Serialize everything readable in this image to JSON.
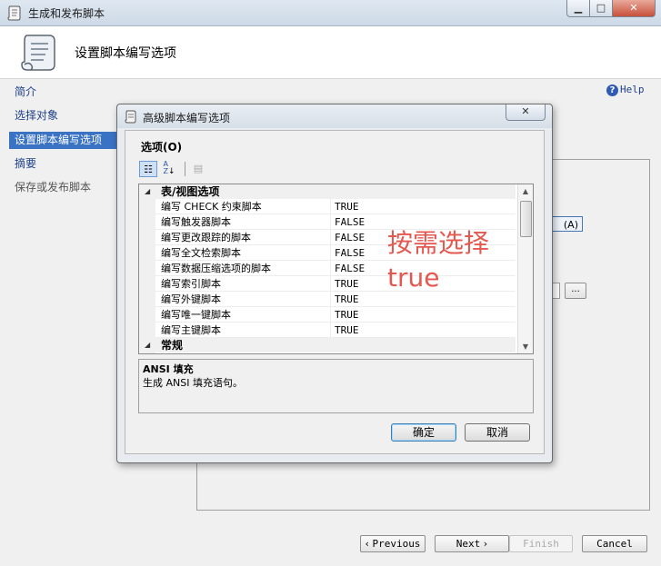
{
  "window": {
    "title": "生成和发布脚本"
  },
  "header": {
    "title": "设置脚本编写选项"
  },
  "help": {
    "label": "Help"
  },
  "nav": {
    "items": [
      {
        "label": "简介",
        "state": "link"
      },
      {
        "label": "选择对象",
        "state": "link"
      },
      {
        "label": "设置脚本编写选项",
        "state": "selected"
      },
      {
        "label": "摘要",
        "state": "link"
      },
      {
        "label": "保存或发布脚本",
        "state": "disabled"
      }
    ]
  },
  "background": {
    "hidden_button_suffix": "(A)",
    "browse_label": "..."
  },
  "wizard_buttons": {
    "previous": "Previous",
    "next": "Next",
    "finish": "Finish",
    "cancel": "Cancel"
  },
  "dialog": {
    "title": "高级脚本编写选项",
    "options_label": "选项(O)",
    "categories": [
      {
        "label": "表/视图选项",
        "expanded": true,
        "rows": [
          {
            "name": "编写 CHECK 约束脚本",
            "value": "TRUE"
          },
          {
            "name": "编写触发器脚本",
            "value": "FALSE"
          },
          {
            "name": "编写更改跟踪的脚本",
            "value": "FALSE"
          },
          {
            "name": "编写全文检索脚本",
            "value": "FALSE"
          },
          {
            "name": "编写数据压缩选项的脚本",
            "value": "FALSE"
          },
          {
            "name": "编写索引脚本",
            "value": "TRUE"
          },
          {
            "name": "编写外键脚本",
            "value": "TRUE"
          },
          {
            "name": "编写唯一键脚本",
            "value": "TRUE"
          },
          {
            "name": "编写主键脚本",
            "value": "TRUE"
          }
        ]
      },
      {
        "label": "常规",
        "expanded": true,
        "rows": []
      }
    ],
    "annotation": "按需选择true",
    "description": {
      "title": "ANSI 填充",
      "text": "生成 ANSI 填充语句。"
    },
    "ok_label": "确定",
    "cancel_label": "取消"
  },
  "colors": {
    "nav_selected": "#3a72c4",
    "annotation": "#e4584f",
    "link": "#1e3f8a"
  }
}
